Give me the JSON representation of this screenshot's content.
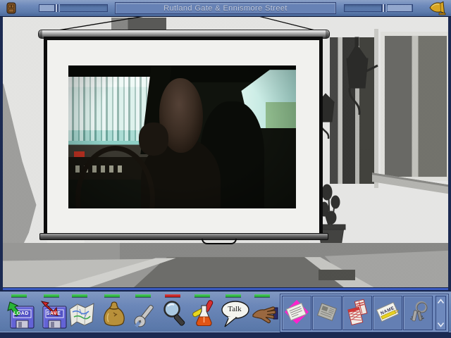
{
  "window": {
    "title": "Rutland Gate & Ennismore Street"
  },
  "colors": {
    "bar_blue": "#7592c4",
    "navy": "#1b2a52",
    "separator_blue": "#3a5abf",
    "indicator_green": "#2cb23c",
    "indicator_red": "#cc2222",
    "highlight_magenta": "#ff22cc",
    "bell_gold": "#e0a818",
    "screen_white": "#f1f1ee"
  },
  "titlebar": {
    "left_icon": "door-icon",
    "right_icon": "bell-icon"
  },
  "toolbar": {
    "tools": [
      {
        "id": "load",
        "label": "LOAD",
        "icon": "floppy-load-icon",
        "indicator": "green"
      },
      {
        "id": "save",
        "label": "SAVE",
        "icon": "floppy-save-icon",
        "indicator": "green"
      },
      {
        "id": "map",
        "icon": "map-icon",
        "indicator": "green"
      },
      {
        "id": "money-bag",
        "icon": "money-bag-icon",
        "indicator": "green"
      },
      {
        "id": "wrench",
        "icon": "wrench-icon",
        "indicator": "green"
      },
      {
        "id": "magnifier",
        "icon": "magnifier-icon",
        "indicator": "red"
      },
      {
        "id": "flask",
        "icon": "flask-icon",
        "indicator": "green"
      },
      {
        "id": "talk",
        "label": "Talk",
        "icon": "speech-bubble-icon",
        "indicator": "green"
      },
      {
        "id": "hand",
        "icon": "hand-icon",
        "indicator": "green"
      }
    ],
    "inventory": {
      "items": [
        {
          "id": "receipt",
          "icon": "receipt-on-magenta-diamond-icon",
          "highlighted": true
        },
        {
          "id": "newspaper",
          "icon": "newspaper-clipping-icon",
          "highlighted": false
        },
        {
          "id": "red-packet",
          "icon": "red-striped-packet-icon",
          "highlighted": false
        },
        {
          "id": "name-card",
          "label": "NAME",
          "icon": "name-card-pencil-icon",
          "highlighted": false
        },
        {
          "id": "keys",
          "icon": "key-ring-icon",
          "highlighted": false
        }
      ]
    }
  }
}
